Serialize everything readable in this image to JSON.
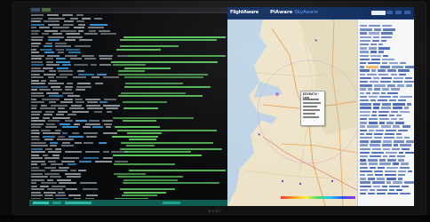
{
  "photo": {
    "description_tag": "monitor-photo"
  },
  "terminal": {
    "title": "",
    "accent": "#33c2a8",
    "text_colors": [
      "#9aa3ad",
      "#5fd15f",
      "#3fa9f5",
      "#d6d6d6"
    ]
  },
  "flightaware": {
    "logo": "FlightAware",
    "brand": "PiAware",
    "brand_sub": "SkyAware",
    "popup_title": "EZY8474 - Low",
    "header_color": "#0c2a5c",
    "accent_orange": "#f0a030"
  },
  "monitor": {
    "maker": "acer"
  }
}
